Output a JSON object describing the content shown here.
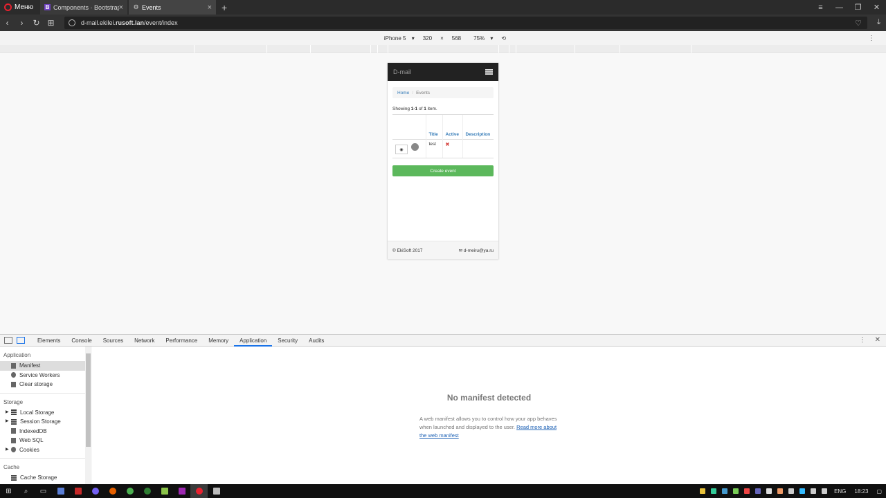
{
  "browser": {
    "menu_label": "Меню",
    "tabs": [
      {
        "label": "Components · Bootstrap",
        "favicon": "B"
      },
      {
        "label": "Events",
        "favicon": "⚙"
      }
    ],
    "url_host": "d-mail.ekilei.",
    "url_domain": "rusoft.lan",
    "url_path": "/event/index"
  },
  "device_toolbar": {
    "device": "iPhone 5",
    "width": "320",
    "times": "×",
    "height": "568",
    "zoom": "75%"
  },
  "site": {
    "brand": "D-mail",
    "breadcrumb": {
      "home": "Home",
      "sep": "/",
      "current": "Events"
    },
    "summary_prefix": "Showing ",
    "summary_range": "1-1",
    "summary_mid": " of ",
    "summary_total": "1",
    "summary_suffix": " item.",
    "table": {
      "headers": [
        "Title",
        "Active",
        "Description"
      ],
      "rows": [
        {
          "title": "test",
          "active": "✖",
          "description": ""
        }
      ]
    },
    "create_button": "Create event",
    "footer_left": "© EkiSoft 2017",
    "footer_right": "✉ d-meiru@ya.ru"
  },
  "devtools": {
    "tabs": [
      "Elements",
      "Console",
      "Sources",
      "Network",
      "Performance",
      "Memory",
      "Application",
      "Security",
      "Audits"
    ],
    "active_tab": "Application",
    "sidebar": {
      "application_title": "Application",
      "application_items": [
        "Manifest",
        "Service Workers",
        "Clear storage"
      ],
      "storage_title": "Storage",
      "storage_items": [
        "Local Storage",
        "Session Storage",
        "IndexedDB",
        "Web SQL",
        "Cookies"
      ],
      "cache_title": "Cache",
      "cache_items": [
        "Cache Storage"
      ]
    },
    "main": {
      "title": "No manifest detected",
      "desc": "A web manifest allows you to control how your app behaves when launched and displayed to the user.",
      "link": "Read more about the web manifest"
    }
  },
  "taskbar": {
    "lang": "ENG",
    "time": "18:23"
  }
}
